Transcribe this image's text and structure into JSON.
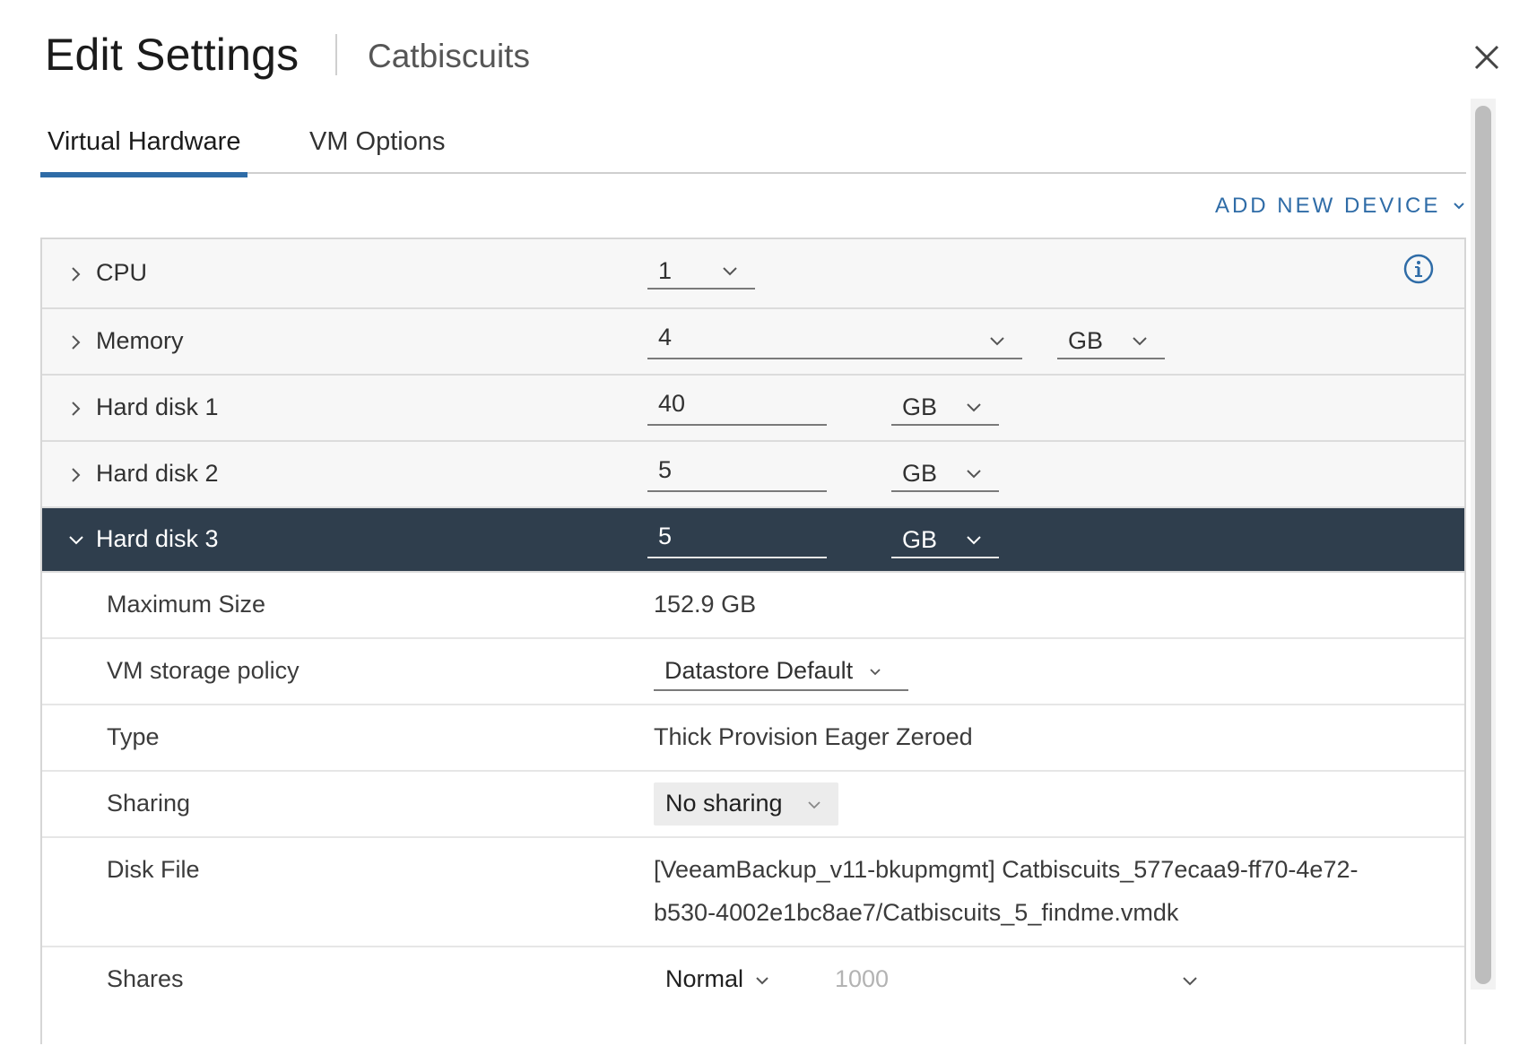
{
  "header": {
    "title": "Edit Settings",
    "subtitle": "Catbiscuits"
  },
  "tabs": [
    {
      "label": "Virtual Hardware",
      "active": true
    },
    {
      "label": "VM Options",
      "active": false
    }
  ],
  "toolbar": {
    "add_device_label": "ADD NEW DEVICE"
  },
  "devices": {
    "cpu": {
      "label": "CPU",
      "value": "1"
    },
    "memory": {
      "label": "Memory",
      "value": "4",
      "unit": "GB"
    },
    "disk1": {
      "label": "Hard disk 1",
      "value": "40",
      "unit": "GB"
    },
    "disk2": {
      "label": "Hard disk 2",
      "value": "5",
      "unit": "GB"
    },
    "disk3": {
      "label": "Hard disk 3",
      "value": "5",
      "unit": "GB"
    }
  },
  "disk3_details": {
    "max_size": {
      "label": "Maximum Size",
      "value": "152.9 GB"
    },
    "policy": {
      "label": "VM storage policy",
      "value": "Datastore Default"
    },
    "type": {
      "label": "Type",
      "value": "Thick Provision Eager Zeroed"
    },
    "sharing": {
      "label": "Sharing",
      "value": "No sharing"
    },
    "disk_file": {
      "label": "Disk File",
      "line1": "[VeeamBackup_v11-bkupmgmt] Catbiscuits_577ecaa9-ff70-4e72-",
      "line2": "b530-4002e1bc8ae7/Catbiscuits_5_findme.vmdk"
    },
    "shares": {
      "label": "Shares",
      "level": "Normal",
      "value": "1000"
    }
  },
  "colors": {
    "accent": "#2f6ca7",
    "selected_row": "#2f3e4d"
  },
  "icons": {
    "close": "close-icon",
    "info": "info-icon",
    "chevron": "chevron-icon"
  }
}
